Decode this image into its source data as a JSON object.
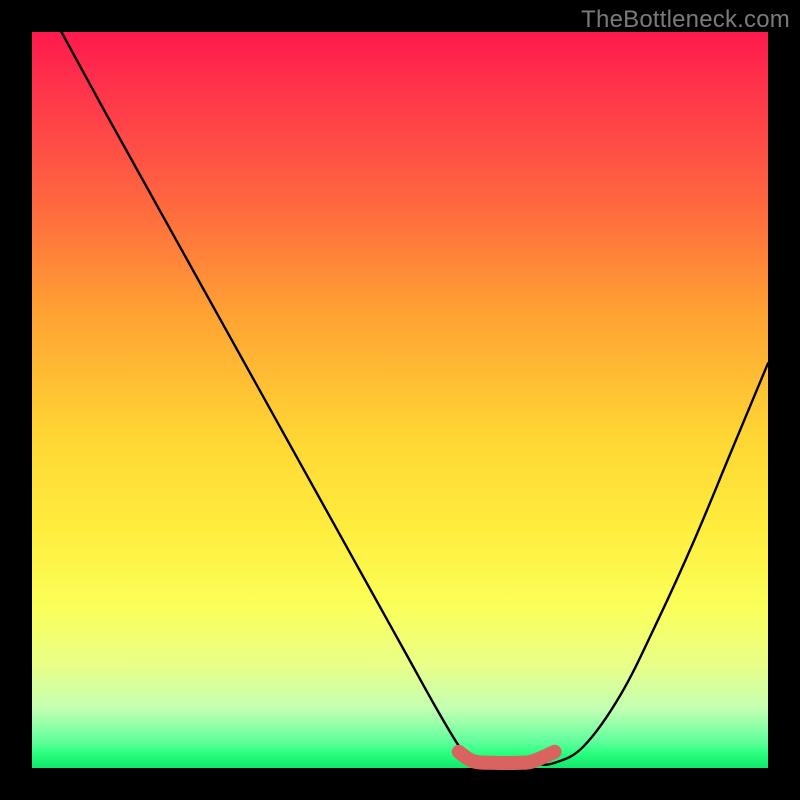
{
  "watermark": "TheBottleneck.com",
  "chart_data": {
    "type": "line",
    "title": "",
    "xlabel": "",
    "ylabel": "",
    "xlim": [
      0,
      100
    ],
    "ylim": [
      0,
      100
    ],
    "grid": false,
    "legend": false,
    "series": [
      {
        "name": "bottleneck-curve",
        "color": "#000000",
        "x": [
          4,
          10,
          20,
          30,
          40,
          50,
          55,
          58,
          60,
          63,
          68,
          71,
          75,
          80,
          85,
          90,
          95,
          100
        ],
        "y": [
          100,
          89,
          71,
          53,
          35,
          17,
          8,
          3,
          0.7,
          0.5,
          0.5,
          0.7,
          3,
          10,
          20,
          31,
          43,
          55
        ]
      },
      {
        "name": "optimal-band",
        "color": "#d9635e",
        "x": [
          58,
          60,
          63,
          66,
          68,
          71
        ],
        "y": [
          2.2,
          0.9,
          0.7,
          0.7,
          0.9,
          2.2
        ]
      }
    ],
    "background_gradient": {
      "stops": [
        {
          "pos": 0.0,
          "color": "#ff1a4d"
        },
        {
          "pos": 0.1,
          "color": "#ff3b4a"
        },
        {
          "pos": 0.24,
          "color": "#ff6a3f"
        },
        {
          "pos": 0.38,
          "color": "#ffa133"
        },
        {
          "pos": 0.55,
          "color": "#ffd634"
        },
        {
          "pos": 0.68,
          "color": "#ffee3e"
        },
        {
          "pos": 0.78,
          "color": "#fbff59"
        },
        {
          "pos": 0.86,
          "color": "#e9ff88"
        },
        {
          "pos": 0.92,
          "color": "#c3ffb3"
        },
        {
          "pos": 0.965,
          "color": "#5eff9c"
        },
        {
          "pos": 0.98,
          "color": "#2aff7e"
        },
        {
          "pos": 1.0,
          "color": "#10e86c"
        }
      ]
    }
  }
}
